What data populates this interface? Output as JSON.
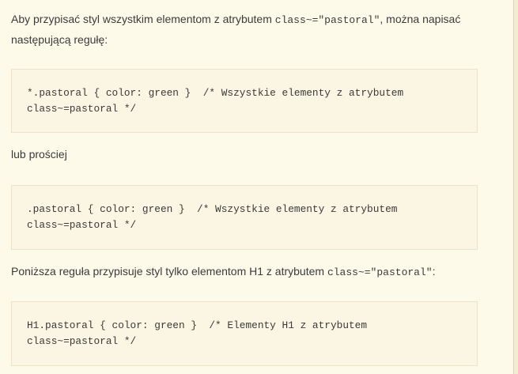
{
  "content": {
    "para1": {
      "text_before": "Aby przypisać styl wszystkim elementom z atrybutem ",
      "code": "class~=\"pastoral\"",
      "text_after": ", można napisać następującą regułę:"
    },
    "code1": {
      "line1": "*.pastoral { color: green }  /* Wszystkie elementy z atrybutem",
      "line2": "class~=pastoral */"
    },
    "para2": {
      "text": "lub prościej"
    },
    "code2": {
      "line1": ".pastoral { color: green }  /* Wszystkie elementy z atrybutem",
      "line2": "class~=pastoral */"
    },
    "para3": {
      "text_before": "Poniższa reguła przypisuje styl tylko elementom H1 z atrybutem ",
      "code": "class~=\"pastoral\"",
      "text_after": ":"
    },
    "code3": {
      "line1": "H1.pastoral { color: green }  /* Elementy H1 z atrybutem",
      "line2": "class~=pastoral */"
    }
  }
}
